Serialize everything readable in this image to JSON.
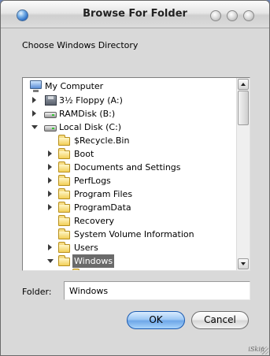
{
  "window": {
    "title": "Browse For Folder",
    "prompt": "Choose Windows Directory",
    "brand": "iSkin"
  },
  "tree": {
    "items": [
      {
        "label": "My Computer",
        "icon": "computer-icon",
        "expander": "none"
      },
      {
        "label": "3½ Floppy (A:)",
        "icon": "floppy-drive-icon",
        "expander": "collapsed"
      },
      {
        "label": "RAMDisk (B:)",
        "icon": "hard-drive-icon",
        "expander": "collapsed"
      },
      {
        "label": "Local Disk (C:)",
        "icon": "hard-drive-icon",
        "expander": "expanded"
      },
      {
        "label": "$Recycle.Bin",
        "icon": "folder-icon",
        "expander": "none"
      },
      {
        "label": "Boot",
        "icon": "folder-icon",
        "expander": "collapsed"
      },
      {
        "label": "Documents and Settings",
        "icon": "folder-icon",
        "expander": "collapsed"
      },
      {
        "label": "PerfLogs",
        "icon": "folder-icon",
        "expander": "collapsed"
      },
      {
        "label": "Program Files",
        "icon": "folder-icon",
        "expander": "collapsed"
      },
      {
        "label": "ProgramData",
        "icon": "folder-icon",
        "expander": "collapsed"
      },
      {
        "label": "Recovery",
        "icon": "folder-icon",
        "expander": "none"
      },
      {
        "label": "System Volume Information",
        "icon": "folder-icon",
        "expander": "none"
      },
      {
        "label": "Users",
        "icon": "folder-icon",
        "expander": "collapsed"
      },
      {
        "label": "Windows",
        "icon": "folder-icon",
        "expander": "expanded",
        "selected": true
      }
    ]
  },
  "folder": {
    "label": "Folder:",
    "value": "Windows"
  },
  "buttons": {
    "ok": "OK",
    "cancel": "Cancel"
  },
  "colors": {
    "selection": "#6a6a6a",
    "ok_button": "#9ec8f5"
  }
}
